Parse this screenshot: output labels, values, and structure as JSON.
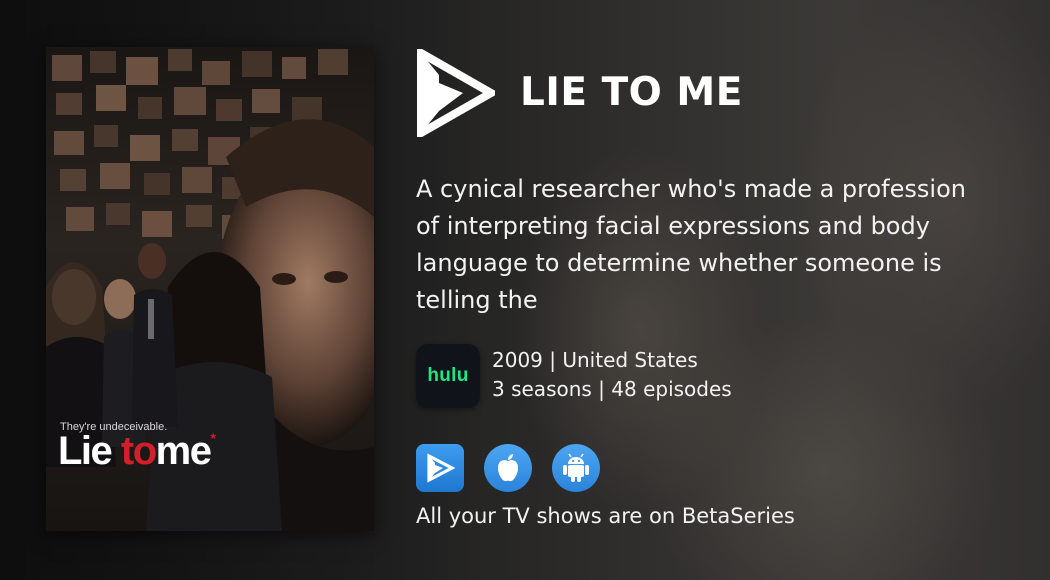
{
  "show": {
    "title": "LIE TO ME",
    "description": "A cynical researcher who's made a profession of interpreting facial expressions and body language to determine whether someone is telling the",
    "year_country": "2009 | United States",
    "seasons_episodes": "3 seasons | 48 episodes"
  },
  "poster": {
    "tagline": "They're undeceivable.",
    "title_part1": "Lie ",
    "title_part2": "to",
    "title_part3": "me",
    "title_mark": "*"
  },
  "provider": {
    "name": "hulu",
    "color": "#1ce783"
  },
  "brand": {
    "logo_icon": "betaseries-play-icon"
  },
  "app_buttons": [
    {
      "icon": "betaseries-app-icon"
    },
    {
      "icon": "apple-icon"
    },
    {
      "icon": "android-icon"
    }
  ],
  "footer": {
    "text": "All your TV shows are on BetaSeries"
  },
  "colors": {
    "accent_blue": "#2a84da",
    "poster_red": "#d21f2b"
  }
}
